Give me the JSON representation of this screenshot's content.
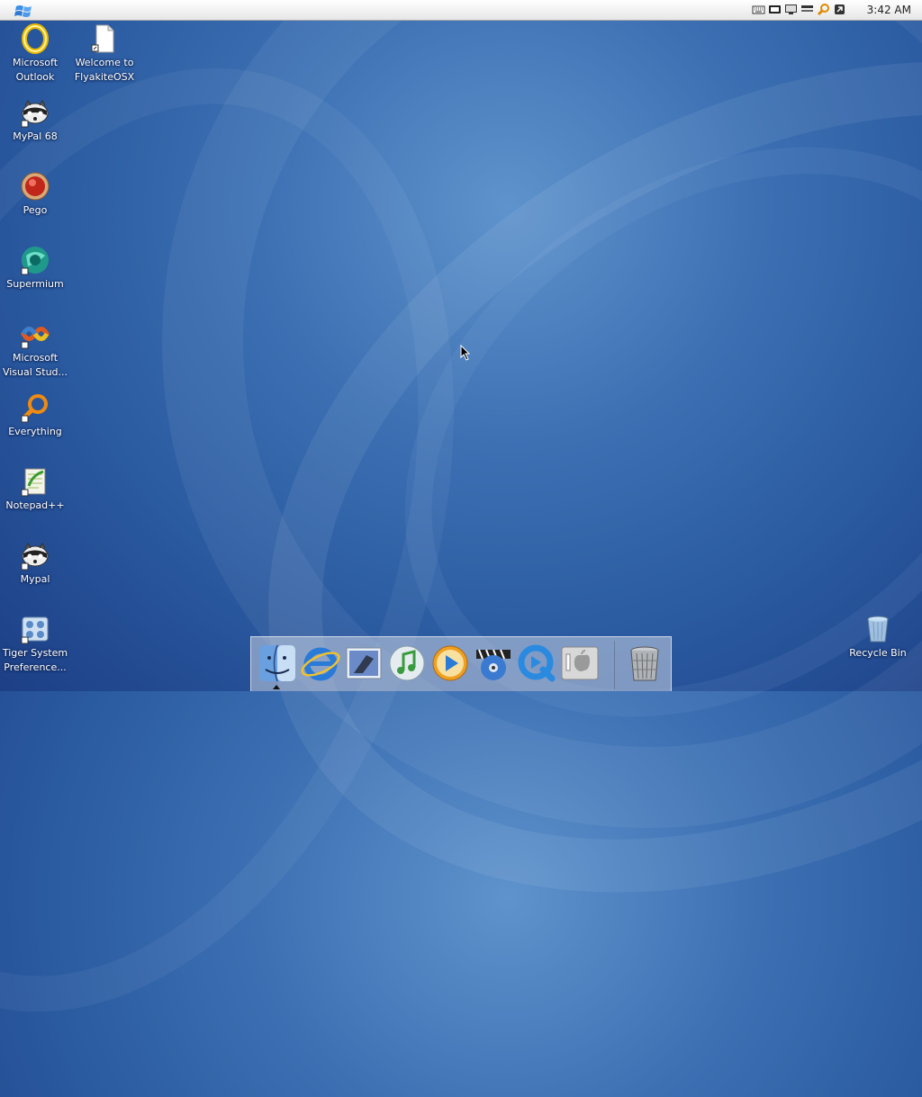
{
  "menubar": {
    "start_icon": "windows-flag-icon",
    "tray_icons": [
      "keyboard-icon",
      "display-icon",
      "monitor-icon",
      "volume-icon",
      "search-icon",
      "network-icon"
    ],
    "clock": "3:42 AM"
  },
  "desktop": {
    "icons": [
      {
        "label": "Microsoft Outlook",
        "icon": "outlook-icon"
      },
      {
        "label": "Welcome to FlyakiteOSX",
        "icon": "document-icon"
      },
      {
        "label": "MyPal 68",
        "icon": "mypal-icon"
      },
      {
        "label": "Pego",
        "icon": "pego-icon"
      },
      {
        "label": "Supermium",
        "icon": "supermium-icon"
      },
      {
        "label": "Microsoft Visual Stud...",
        "icon": "visual-studio-icon"
      },
      {
        "label": "Everything",
        "icon": "search-icon"
      },
      {
        "label": "Notepad++",
        "icon": "notepad-icon"
      },
      {
        "label": "Mypal",
        "icon": "mypal-icon"
      },
      {
        "label": "Tiger System Preference...",
        "icon": "system-preferences-icon"
      },
      {
        "label": "Recycle Bin",
        "icon": "recycle-bin-icon"
      }
    ]
  },
  "dock": {
    "items": [
      "finder-icon",
      "internet-explorer-icon",
      "mail-icon",
      "itunes-icon",
      "media-player-icon",
      "dvd-player-icon",
      "quicktime-icon",
      "system-preferences-icon"
    ],
    "trash": "trash-icon"
  },
  "colors": {
    "desktop_bg": "#2a5aa0",
    "menubar_bg": "#f0f0f0",
    "label_text": "#ffffff"
  }
}
